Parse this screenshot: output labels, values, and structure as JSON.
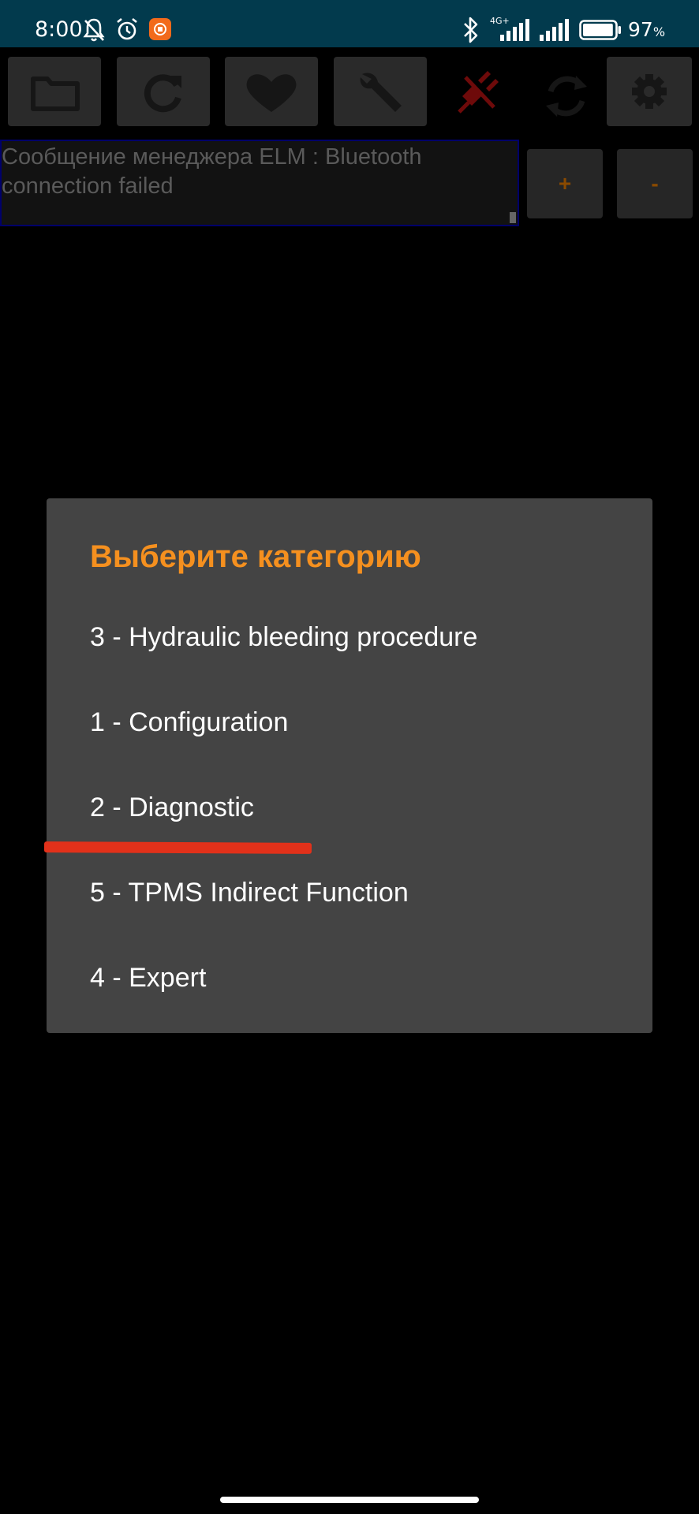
{
  "status_bar": {
    "time": "8:00",
    "network_type": "4G+",
    "battery_percent": "97",
    "battery_symbol": "%",
    "battery_level": 0.97,
    "icons": [
      "mute-bell-icon",
      "alarm-icon",
      "mi-app-icon",
      "bluetooth-icon",
      "signal-icon",
      "signal-icon",
      "battery-icon"
    ]
  },
  "toolbar": {
    "icons": [
      "folder-icon",
      "refresh-icon",
      "heart-icon",
      "wrench-icon",
      "disconnected-icon",
      "sync-icon",
      "settings-icon"
    ]
  },
  "log": {
    "text": "Сообщение менеджера ELM : Bluetooth connection failed"
  },
  "zoom": {
    "plus_label": "+",
    "minus_label": "-"
  },
  "dialog": {
    "title": "Выберите категорию",
    "items": [
      {
        "label": "3 - Hydraulic bleeding procedure"
      },
      {
        "label": "1 - Configuration"
      },
      {
        "label": "2 - Diagnostic"
      },
      {
        "label": "5 - TPMS Indirect Function"
      },
      {
        "label": "4 - Expert"
      }
    ]
  },
  "colors": {
    "status_bar_bg": "#023a4d",
    "accent_orange": "#f5901f",
    "dialog_bg": "#444444",
    "annotation_red": "#e2311a"
  }
}
